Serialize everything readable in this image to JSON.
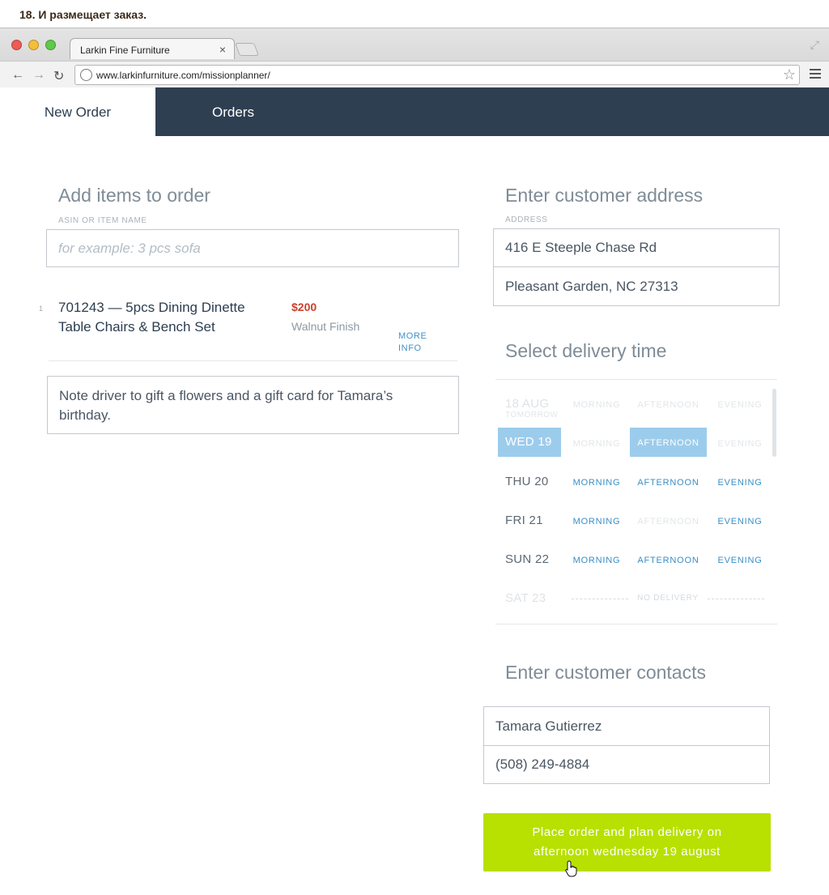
{
  "caption": "18. И размещает заказ.",
  "browser": {
    "tab_title": "Larkin Fine Furniture",
    "url": "www.larkinfurniture.com/missionplanner/"
  },
  "nav": {
    "new_order": "New Order",
    "orders": "Orders"
  },
  "items_section": {
    "title": "Add items to order",
    "label": "ASIN OR ITEM NAME",
    "placeholder": "for example: 3 pcs sofa",
    "items": [
      {
        "index": "1",
        "title": "701243 — 5pcs Dining Dinette Table Chairs & Bench Set",
        "price": "$200",
        "finish": "Walnut Finish",
        "more_info": "MORE INFO"
      }
    ],
    "note": "Note driver to gift a flowers and a gift card for Tamara’s birthday."
  },
  "address_section": {
    "title": "Enter customer address",
    "label": "ADDRESS",
    "line1": "416 E Steeple Chase Rd",
    "line2": "Pleasant Garden, NC 27313"
  },
  "delivery_section": {
    "title": "Select delivery time",
    "days": [
      {
        "label": "18 AUG",
        "sub": "TOMORROW",
        "morning": "MORNING",
        "afternoon": "AFTERNOON",
        "evening": "EVENING"
      },
      {
        "label": "WED 19",
        "morning": "MORNING",
        "afternoon": "AFTERNOON",
        "evening": "EVENING"
      },
      {
        "label": "THU 20",
        "morning": "MORNING",
        "afternoon": "AFTERNOON",
        "evening": "EVENING"
      },
      {
        "label": "FRI 21",
        "morning": "MORNING",
        "afternoon": "AFTERNOON",
        "evening": "EVENING"
      },
      {
        "label": "SUN 22",
        "morning": "MORNING",
        "afternoon": "AFTERNOON",
        "evening": "EVENING"
      },
      {
        "label": "SAT 23",
        "no_delivery": "NO DELIVERY"
      }
    ],
    "selected_day": "WED 19",
    "selected_slot": "AFTERNOON"
  },
  "contacts_section": {
    "title": "Enter customer contacts",
    "name": "Tamara Gutierrez",
    "phone": "(508) 249-4884"
  },
  "cta": {
    "label": "Place order and plan delivery on afternoon wednesday 19 august"
  },
  "colors": {
    "nav_bg": "#2e3f52",
    "cta_bg": "#b8e000",
    "price": "#c9412f",
    "link": "#3a8fc6",
    "selected": "#9cccec"
  }
}
